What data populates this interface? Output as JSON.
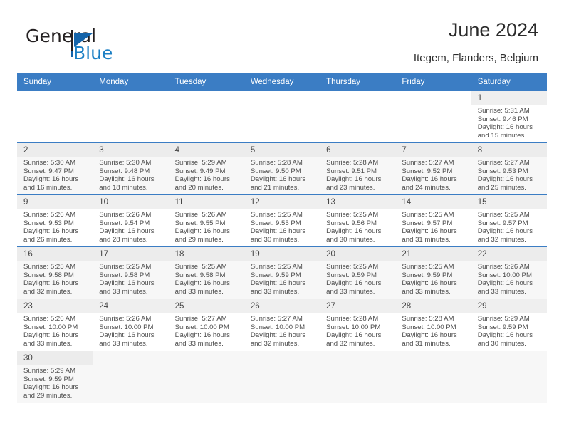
{
  "brand": {
    "name_part1": "General",
    "name_part2": "Blue",
    "color_primary": "#1464aa",
    "color_accent": "#1b7fc4"
  },
  "header": {
    "title": "June 2024",
    "subtitle": "Itegem, Flanders, Belgium",
    "header_bg": "#3b7dc4"
  },
  "calendar": {
    "weekdays": [
      "Sunday",
      "Monday",
      "Tuesday",
      "Wednesday",
      "Thursday",
      "Friday",
      "Saturday"
    ],
    "labels": {
      "sunrise_prefix": "Sunrise:",
      "sunset_prefix": "Sunset:",
      "daylight_prefix": "Daylight:"
    },
    "weeks": [
      [
        {
          "empty": true
        },
        {
          "empty": true
        },
        {
          "empty": true
        },
        {
          "empty": true
        },
        {
          "empty": true
        },
        {
          "empty": true
        },
        {
          "day": "1",
          "sunrise": "Sunrise: 5:31 AM",
          "sunset": "Sunset: 9:46 PM",
          "daylight1": "Daylight: 16 hours",
          "daylight2": "and 15 minutes."
        }
      ],
      [
        {
          "day": "2",
          "sunrise": "Sunrise: 5:30 AM",
          "sunset": "Sunset: 9:47 PM",
          "daylight1": "Daylight: 16 hours",
          "daylight2": "and 16 minutes."
        },
        {
          "day": "3",
          "sunrise": "Sunrise: 5:30 AM",
          "sunset": "Sunset: 9:48 PM",
          "daylight1": "Daylight: 16 hours",
          "daylight2": "and 18 minutes."
        },
        {
          "day": "4",
          "sunrise": "Sunrise: 5:29 AM",
          "sunset": "Sunset: 9:49 PM",
          "daylight1": "Daylight: 16 hours",
          "daylight2": "and 20 minutes."
        },
        {
          "day": "5",
          "sunrise": "Sunrise: 5:28 AM",
          "sunset": "Sunset: 9:50 PM",
          "daylight1": "Daylight: 16 hours",
          "daylight2": "and 21 minutes."
        },
        {
          "day": "6",
          "sunrise": "Sunrise: 5:28 AM",
          "sunset": "Sunset: 9:51 PM",
          "daylight1": "Daylight: 16 hours",
          "daylight2": "and 23 minutes."
        },
        {
          "day": "7",
          "sunrise": "Sunrise: 5:27 AM",
          "sunset": "Sunset: 9:52 PM",
          "daylight1": "Daylight: 16 hours",
          "daylight2": "and 24 minutes."
        },
        {
          "day": "8",
          "sunrise": "Sunrise: 5:27 AM",
          "sunset": "Sunset: 9:53 PM",
          "daylight1": "Daylight: 16 hours",
          "daylight2": "and 25 minutes."
        }
      ],
      [
        {
          "day": "9",
          "sunrise": "Sunrise: 5:26 AM",
          "sunset": "Sunset: 9:53 PM",
          "daylight1": "Daylight: 16 hours",
          "daylight2": "and 26 minutes."
        },
        {
          "day": "10",
          "sunrise": "Sunrise: 5:26 AM",
          "sunset": "Sunset: 9:54 PM",
          "daylight1": "Daylight: 16 hours",
          "daylight2": "and 28 minutes."
        },
        {
          "day": "11",
          "sunrise": "Sunrise: 5:26 AM",
          "sunset": "Sunset: 9:55 PM",
          "daylight1": "Daylight: 16 hours",
          "daylight2": "and 29 minutes."
        },
        {
          "day": "12",
          "sunrise": "Sunrise: 5:25 AM",
          "sunset": "Sunset: 9:55 PM",
          "daylight1": "Daylight: 16 hours",
          "daylight2": "and 30 minutes."
        },
        {
          "day": "13",
          "sunrise": "Sunrise: 5:25 AM",
          "sunset": "Sunset: 9:56 PM",
          "daylight1": "Daylight: 16 hours",
          "daylight2": "and 30 minutes."
        },
        {
          "day": "14",
          "sunrise": "Sunrise: 5:25 AM",
          "sunset": "Sunset: 9:57 PM",
          "daylight1": "Daylight: 16 hours",
          "daylight2": "and 31 minutes."
        },
        {
          "day": "15",
          "sunrise": "Sunrise: 5:25 AM",
          "sunset": "Sunset: 9:57 PM",
          "daylight1": "Daylight: 16 hours",
          "daylight2": "and 32 minutes."
        }
      ],
      [
        {
          "day": "16",
          "sunrise": "Sunrise: 5:25 AM",
          "sunset": "Sunset: 9:58 PM",
          "daylight1": "Daylight: 16 hours",
          "daylight2": "and 32 minutes."
        },
        {
          "day": "17",
          "sunrise": "Sunrise: 5:25 AM",
          "sunset": "Sunset: 9:58 PM",
          "daylight1": "Daylight: 16 hours",
          "daylight2": "and 33 minutes."
        },
        {
          "day": "18",
          "sunrise": "Sunrise: 5:25 AM",
          "sunset": "Sunset: 9:58 PM",
          "daylight1": "Daylight: 16 hours",
          "daylight2": "and 33 minutes."
        },
        {
          "day": "19",
          "sunrise": "Sunrise: 5:25 AM",
          "sunset": "Sunset: 9:59 PM",
          "daylight1": "Daylight: 16 hours",
          "daylight2": "and 33 minutes."
        },
        {
          "day": "20",
          "sunrise": "Sunrise: 5:25 AM",
          "sunset": "Sunset: 9:59 PM",
          "daylight1": "Daylight: 16 hours",
          "daylight2": "and 33 minutes."
        },
        {
          "day": "21",
          "sunrise": "Sunrise: 5:25 AM",
          "sunset": "Sunset: 9:59 PM",
          "daylight1": "Daylight: 16 hours",
          "daylight2": "and 33 minutes."
        },
        {
          "day": "22",
          "sunrise": "Sunrise: 5:26 AM",
          "sunset": "Sunset: 10:00 PM",
          "daylight1": "Daylight: 16 hours",
          "daylight2": "and 33 minutes."
        }
      ],
      [
        {
          "day": "23",
          "sunrise": "Sunrise: 5:26 AM",
          "sunset": "Sunset: 10:00 PM",
          "daylight1": "Daylight: 16 hours",
          "daylight2": "and 33 minutes."
        },
        {
          "day": "24",
          "sunrise": "Sunrise: 5:26 AM",
          "sunset": "Sunset: 10:00 PM",
          "daylight1": "Daylight: 16 hours",
          "daylight2": "and 33 minutes."
        },
        {
          "day": "25",
          "sunrise": "Sunrise: 5:27 AM",
          "sunset": "Sunset: 10:00 PM",
          "daylight1": "Daylight: 16 hours",
          "daylight2": "and 33 minutes."
        },
        {
          "day": "26",
          "sunrise": "Sunrise: 5:27 AM",
          "sunset": "Sunset: 10:00 PM",
          "daylight1": "Daylight: 16 hours",
          "daylight2": "and 32 minutes."
        },
        {
          "day": "27",
          "sunrise": "Sunrise: 5:28 AM",
          "sunset": "Sunset: 10:00 PM",
          "daylight1": "Daylight: 16 hours",
          "daylight2": "and 32 minutes."
        },
        {
          "day": "28",
          "sunrise": "Sunrise: 5:28 AM",
          "sunset": "Sunset: 10:00 PM",
          "daylight1": "Daylight: 16 hours",
          "daylight2": "and 31 minutes."
        },
        {
          "day": "29",
          "sunrise": "Sunrise: 5:29 AM",
          "sunset": "Sunset: 9:59 PM",
          "daylight1": "Daylight: 16 hours",
          "daylight2": "and 30 minutes."
        }
      ],
      [
        {
          "day": "30",
          "sunrise": "Sunrise: 5:29 AM",
          "sunset": "Sunset: 9:59 PM",
          "daylight1": "Daylight: 16 hours",
          "daylight2": "and 29 minutes."
        },
        {
          "empty": true
        },
        {
          "empty": true
        },
        {
          "empty": true
        },
        {
          "empty": true
        },
        {
          "empty": true
        },
        {
          "empty": true
        }
      ]
    ]
  }
}
